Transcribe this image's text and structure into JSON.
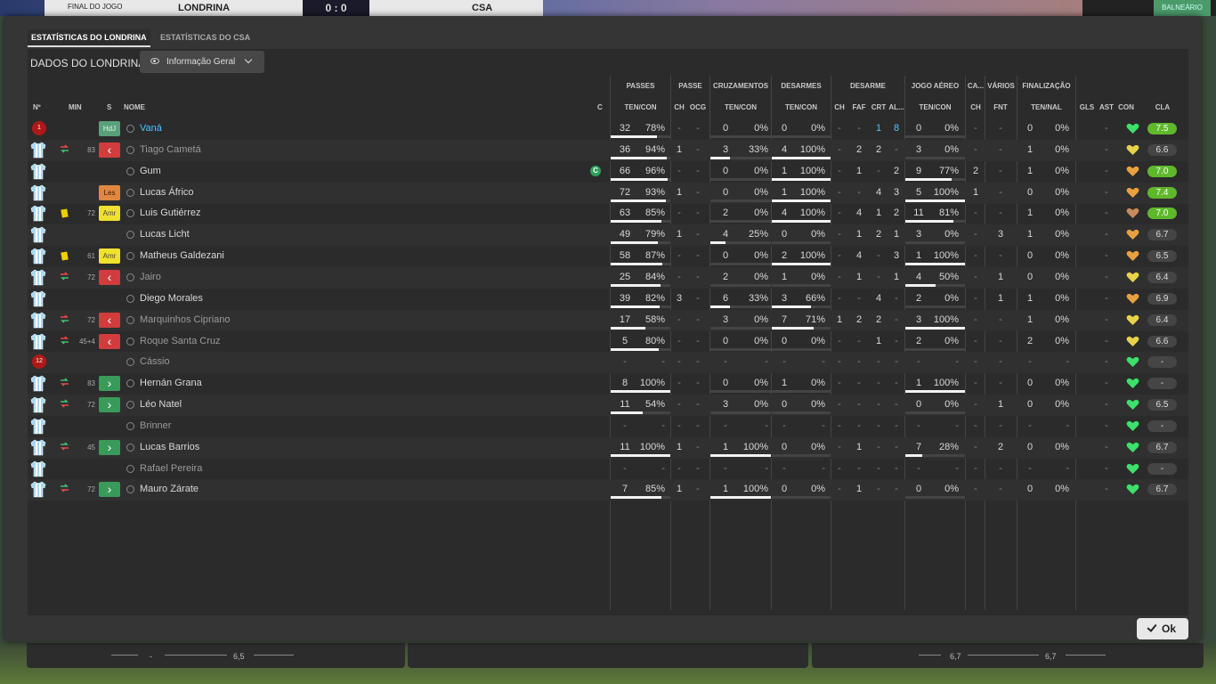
{
  "background": {
    "status": "FINAL DO JOGO",
    "home_team": "LONDRINA",
    "score": "0 : 0",
    "away_team": "CSA",
    "locker_btn": "BALNEÁRIO",
    "footer_values": [
      "-",
      "6,5",
      "6,7",
      "6,7"
    ]
  },
  "tabs": [
    {
      "label": "ESTATÍSTICAS DO LONDRINA",
      "active": true
    },
    {
      "label": "ESTATÍSTICAS DO CSA",
      "active": false
    }
  ],
  "panel": {
    "title": "DADOS DO LONDRINA",
    "view_select": "Informação Geral"
  },
  "headers": {
    "groups": [
      "PASSES",
      "PASSE",
      "CRUZAMENTOS",
      "DESARMES",
      "DESARME",
      "JOGO AÉREO",
      "CA...",
      "VÁRIOS",
      "FINALIZAÇÃO"
    ],
    "left": [
      "Nº",
      "MIN",
      "S",
      "NOME",
      "C"
    ],
    "sub": [
      "TEN/CON",
      "CH",
      "OCG",
      "TEN/CON",
      "TEN/CON",
      "CH",
      "FAF",
      "CRT",
      "AL...",
      "TEN/CON",
      "CH",
      "FNT",
      "TEN/NAL",
      "GLS",
      "AST",
      "CON",
      "CLA"
    ]
  },
  "colors": {
    "accent_blue": "#4fc3ff",
    "green": "#5fb82c",
    "red_badge": "#d23c3c",
    "green_badge": "#3a9a5a"
  },
  "players": [
    {
      "name": "Vaná",
      "num": "1",
      "kit": "gk",
      "event": "",
      "min": "",
      "badge": "HdJ",
      "badge_type": "hdj",
      "hl": true,
      "dim": false,
      "cap": false,
      "pass": [
        "32",
        "78%"
      ],
      "pass_fill": 0.78,
      "p_ch": "-",
      "p_ocg": "-",
      "cross": [
        "0",
        "0%"
      ],
      "cross_fill": 0,
      "tk": [
        "0",
        "0%"
      ],
      "tk_fill": 0,
      "d_ch": "-",
      "d_faf": "-",
      "d_crt": "1",
      "d_al": "8",
      "blue_crt": true,
      "blue_al": true,
      "air": [
        "0",
        "0%"
      ],
      "air_fill": 0,
      "ca": "-",
      "fnt": "-",
      "fin": [
        "0",
        "0%"
      ],
      "gls": "",
      "ast": "-",
      "heart": "green",
      "cla": "7.5",
      "cla_green": true
    },
    {
      "name": "Tiago Cametá",
      "num": "",
      "kit": "field",
      "event": "subout",
      "min": "83",
      "badge": "",
      "badge_type": "sub-out",
      "hl": false,
      "dim": true,
      "cap": false,
      "pass": [
        "36",
        "94%"
      ],
      "pass_fill": 0.94,
      "p_ch": "1",
      "p_ocg": "-",
      "cross": [
        "3",
        "33%"
      ],
      "cross_fill": 0.33,
      "tk": [
        "4",
        "100%"
      ],
      "tk_fill": 1,
      "d_ch": "-",
      "d_faf": "2",
      "d_crt": "2",
      "d_al": "-",
      "air": [
        "3",
        "0%"
      ],
      "air_fill": 0,
      "ca": "-",
      "fnt": "-",
      "fin": [
        "1",
        "0%"
      ],
      "gls": "",
      "ast": "-",
      "heart": "yellow",
      "cla": "6.6",
      "cla_green": false
    },
    {
      "name": "Gum",
      "num": "",
      "kit": "field",
      "event": "",
      "min": "",
      "badge": "",
      "badge_type": "",
      "hl": false,
      "dim": false,
      "cap": true,
      "pass": [
        "66",
        "96%"
      ],
      "pass_fill": 0.96,
      "p_ch": "-",
      "p_ocg": "-",
      "cross": [
        "0",
        "0%"
      ],
      "cross_fill": 0,
      "tk": [
        "1",
        "100%"
      ],
      "tk_fill": 1,
      "d_ch": "-",
      "d_faf": "1",
      "d_crt": "-",
      "d_al": "2",
      "air": [
        "9",
        "77%"
      ],
      "air_fill": 0.77,
      "ca": "2",
      "fnt": "-",
      "fin": [
        "1",
        "0%"
      ],
      "gls": "",
      "ast": "-",
      "heart": "orange",
      "cla": "7.0",
      "cla_green": true
    },
    {
      "name": "Lucas Áfrico",
      "num": "",
      "kit": "field",
      "event": "",
      "min": "",
      "badge": "Les",
      "badge_type": "les",
      "hl": false,
      "dim": false,
      "cap": false,
      "pass": [
        "72",
        "93%"
      ],
      "pass_fill": 0.93,
      "p_ch": "1",
      "p_ocg": "-",
      "cross": [
        "0",
        "0%"
      ],
      "cross_fill": 0,
      "tk": [
        "1",
        "100%"
      ],
      "tk_fill": 1,
      "d_ch": "-",
      "d_faf": "-",
      "d_crt": "4",
      "d_al": "3",
      "air": [
        "5",
        "100%"
      ],
      "air_fill": 1,
      "ca": "1",
      "fnt": "-",
      "fin": [
        "0",
        "0%"
      ],
      "gls": "",
      "ast": "-",
      "heart": "orange",
      "cla": "7.4",
      "cla_green": true
    },
    {
      "name": "Luis Gutiérrez",
      "num": "",
      "kit": "field",
      "event": "yellow",
      "min": "72",
      "badge": "Amr",
      "badge_type": "amr",
      "hl": false,
      "dim": false,
      "cap": false,
      "pass": [
        "63",
        "85%"
      ],
      "pass_fill": 0.85,
      "p_ch": "-",
      "p_ocg": "-",
      "cross": [
        "2",
        "0%"
      ],
      "cross_fill": 0,
      "tk": [
        "4",
        "100%"
      ],
      "tk_fill": 1,
      "d_ch": "-",
      "d_faf": "4",
      "d_crt": "1",
      "d_al": "2",
      "air": [
        "11",
        "81%"
      ],
      "air_fill": 0.81,
      "ca": "-",
      "fnt": "-",
      "fin": [
        "1",
        "0%"
      ],
      "gls": "",
      "ast": "-",
      "heart": "brown",
      "cla": "7.0",
      "cla_green": true
    },
    {
      "name": "Lucas Licht",
      "num": "",
      "kit": "field",
      "event": "",
      "min": "",
      "badge": "",
      "badge_type": "",
      "hl": false,
      "dim": false,
      "cap": false,
      "pass": [
        "49",
        "79%"
      ],
      "pass_fill": 0.79,
      "p_ch": "1",
      "p_ocg": "-",
      "cross": [
        "4",
        "25%"
      ],
      "cross_fill": 0.25,
      "tk": [
        "0",
        "0%"
      ],
      "tk_fill": 0,
      "d_ch": "-",
      "d_faf": "1",
      "d_crt": "2",
      "d_al": "1",
      "air": [
        "3",
        "0%"
      ],
      "air_fill": 0,
      "ca": "-",
      "fnt": "3",
      "fin": [
        "1",
        "0%"
      ],
      "gls": "",
      "ast": "-",
      "heart": "orange",
      "cla": "6.7",
      "cla_green": false
    },
    {
      "name": "Matheus Galdezani",
      "num": "",
      "kit": "field",
      "event": "yellow",
      "min": "61",
      "badge": "Amr",
      "badge_type": "amr",
      "hl": false,
      "dim": false,
      "cap": false,
      "pass": [
        "58",
        "87%"
      ],
      "pass_fill": 0.87,
      "p_ch": "-",
      "p_ocg": "-",
      "cross": [
        "0",
        "0%"
      ],
      "cross_fill": 0,
      "tk": [
        "2",
        "100%"
      ],
      "tk_fill": 1,
      "d_ch": "-",
      "d_faf": "4",
      "d_crt": "-",
      "d_al": "3",
      "air": [
        "1",
        "100%"
      ],
      "air_fill": 1,
      "ca": "-",
      "fnt": "-",
      "fin": [
        "0",
        "0%"
      ],
      "gls": "",
      "ast": "-",
      "heart": "orange",
      "cla": "6.5",
      "cla_green": false
    },
    {
      "name": "Jairo",
      "num": "",
      "kit": "field",
      "event": "subout",
      "min": "72",
      "badge": "",
      "badge_type": "sub-out",
      "hl": false,
      "dim": true,
      "cap": false,
      "pass": [
        "25",
        "84%"
      ],
      "pass_fill": 0.84,
      "p_ch": "-",
      "p_ocg": "-",
      "cross": [
        "2",
        "0%"
      ],
      "cross_fill": 0,
      "tk": [
        "1",
        "0%"
      ],
      "tk_fill": 0,
      "d_ch": "-",
      "d_faf": "1",
      "d_crt": "-",
      "d_al": "1",
      "air": [
        "4",
        "50%"
      ],
      "air_fill": 0.5,
      "ca": "-",
      "fnt": "1",
      "fin": [
        "0",
        "0%"
      ],
      "gls": "",
      "ast": "-",
      "heart": "yellow",
      "cla": "6.4",
      "cla_green": false
    },
    {
      "name": "Diego Morales",
      "num": "",
      "kit": "field",
      "event": "",
      "min": "",
      "badge": "",
      "badge_type": "",
      "hl": false,
      "dim": false,
      "cap": false,
      "pass": [
        "39",
        "82%"
      ],
      "pass_fill": 0.82,
      "p_ch": "3",
      "p_ocg": "-",
      "cross": [
        "6",
        "33%"
      ],
      "cross_fill": 0.33,
      "tk": [
        "3",
        "66%"
      ],
      "tk_fill": 0.66,
      "d_ch": "-",
      "d_faf": "-",
      "d_crt": "4",
      "d_al": "-",
      "air": [
        "2",
        "0%"
      ],
      "air_fill": 0,
      "ca": "-",
      "fnt": "1",
      "fin": [
        "1",
        "0%"
      ],
      "gls": "",
      "ast": "-",
      "heart": "orange",
      "cla": "6.9",
      "cla_green": false
    },
    {
      "name": "Marquinhos Cipriano",
      "num": "",
      "kit": "field",
      "event": "subout",
      "min": "72",
      "badge": "",
      "badge_type": "sub-out",
      "hl": false,
      "dim": true,
      "cap": false,
      "pass": [
        "17",
        "58%"
      ],
      "pass_fill": 0.58,
      "p_ch": "-",
      "p_ocg": "-",
      "cross": [
        "3",
        "0%"
      ],
      "cross_fill": 0,
      "tk": [
        "7",
        "71%"
      ],
      "tk_fill": 0.71,
      "d_ch": "1",
      "d_faf": "2",
      "d_crt": "2",
      "d_al": "-",
      "air": [
        "3",
        "100%"
      ],
      "air_fill": 1,
      "ca": "-",
      "fnt": "-",
      "fin": [
        "1",
        "0%"
      ],
      "gls": "",
      "ast": "-",
      "heart": "yellow",
      "cla": "6.4",
      "cla_green": false
    },
    {
      "name": "Roque Santa Cruz",
      "num": "",
      "kit": "field",
      "event": "subout",
      "min": "45+4",
      "badge": "",
      "badge_type": "sub-out",
      "hl": false,
      "dim": true,
      "cap": false,
      "pass": [
        "5",
        "80%"
      ],
      "pass_fill": 0.8,
      "p_ch": "-",
      "p_ocg": "-",
      "cross": [
        "0",
        "0%"
      ],
      "cross_fill": 0,
      "tk": [
        "0",
        "0%"
      ],
      "tk_fill": 0,
      "d_ch": "-",
      "d_faf": "-",
      "d_crt": "1",
      "d_al": "-",
      "air": [
        "2",
        "0%"
      ],
      "air_fill": 0,
      "ca": "-",
      "fnt": "-",
      "fin": [
        "2",
        "0%"
      ],
      "gls": "",
      "ast": "-",
      "heart": "yellow",
      "cla": "6.6",
      "cla_green": false
    },
    {
      "name": "Cássio",
      "num": "12",
      "kit": "gk",
      "event": "",
      "min": "",
      "badge": "",
      "badge_type": "",
      "hl": false,
      "dim": true,
      "cap": false,
      "pass": [
        "-",
        "-"
      ],
      "pass_fill": 0,
      "p_ch": "-",
      "p_ocg": "-",
      "cross": [
        "-",
        "-"
      ],
      "cross_fill": 0,
      "tk": [
        "-",
        "-"
      ],
      "tk_fill": 0,
      "d_ch": "-",
      "d_faf": "-",
      "d_crt": "-",
      "d_al": "-",
      "air": [
        "-",
        "-"
      ],
      "air_fill": 0,
      "ca": "-",
      "fnt": "-",
      "fin": [
        "-",
        "-"
      ],
      "gls": "",
      "ast": "-",
      "heart": "green",
      "cla": "-",
      "cla_green": false
    },
    {
      "name": "Hernán Grana",
      "num": "",
      "kit": "field",
      "event": "subin",
      "min": "83",
      "badge": "",
      "badge_type": "sub-in",
      "hl": false,
      "dim": false,
      "cap": false,
      "pass": [
        "8",
        "100%"
      ],
      "pass_fill": 1,
      "p_ch": "-",
      "p_ocg": "-",
      "cross": [
        "0",
        "0%"
      ],
      "cross_fill": 0,
      "tk": [
        "1",
        "0%"
      ],
      "tk_fill": 0,
      "d_ch": "-",
      "d_faf": "-",
      "d_crt": "-",
      "d_al": "-",
      "air": [
        "1",
        "100%"
      ],
      "air_fill": 1,
      "ca": "-",
      "fnt": "-",
      "fin": [
        "0",
        "0%"
      ],
      "gls": "",
      "ast": "-",
      "heart": "green",
      "cla": "-",
      "cla_green": false
    },
    {
      "name": "Léo Natel",
      "num": "",
      "kit": "field",
      "event": "subin",
      "min": "72",
      "badge": "",
      "badge_type": "sub-in",
      "hl": false,
      "dim": false,
      "cap": false,
      "pass": [
        "11",
        "54%"
      ],
      "pass_fill": 0.54,
      "p_ch": "-",
      "p_ocg": "-",
      "cross": [
        "3",
        "0%"
      ],
      "cross_fill": 0,
      "tk": [
        "0",
        "0%"
      ],
      "tk_fill": 0,
      "d_ch": "-",
      "d_faf": "-",
      "d_crt": "-",
      "d_al": "-",
      "air": [
        "0",
        "0%"
      ],
      "air_fill": 0,
      "ca": "-",
      "fnt": "1",
      "fin": [
        "0",
        "0%"
      ],
      "gls": "",
      "ast": "-",
      "heart": "green",
      "cla": "6.5",
      "cla_green": false
    },
    {
      "name": "Brinner",
      "num": "",
      "kit": "field",
      "event": "",
      "min": "",
      "badge": "",
      "badge_type": "",
      "hl": false,
      "dim": true,
      "cap": false,
      "pass": [
        "-",
        "-"
      ],
      "pass_fill": 0,
      "p_ch": "-",
      "p_ocg": "-",
      "cross": [
        "-",
        "-"
      ],
      "cross_fill": 0,
      "tk": [
        "-",
        "-"
      ],
      "tk_fill": 0,
      "d_ch": "-",
      "d_faf": "-",
      "d_crt": "-",
      "d_al": "-",
      "air": [
        "-",
        "-"
      ],
      "air_fill": 0,
      "ca": "-",
      "fnt": "-",
      "fin": [
        "-",
        "-"
      ],
      "gls": "",
      "ast": "-",
      "heart": "green",
      "cla": "-",
      "cla_green": false
    },
    {
      "name": "Lucas Barrios",
      "num": "",
      "kit": "field",
      "event": "subin",
      "min": "45",
      "badge": "",
      "badge_type": "sub-in",
      "hl": false,
      "dim": false,
      "cap": false,
      "pass": [
        "11",
        "100%"
      ],
      "pass_fill": 1,
      "p_ch": "1",
      "p_ocg": "-",
      "cross": [
        "1",
        "100%"
      ],
      "cross_fill": 1,
      "tk": [
        "0",
        "0%"
      ],
      "tk_fill": 0,
      "d_ch": "-",
      "d_faf": "1",
      "d_crt": "-",
      "d_al": "-",
      "air": [
        "7",
        "28%"
      ],
      "air_fill": 0.28,
      "ca": "-",
      "fnt": "2",
      "fin": [
        "0",
        "0%"
      ],
      "gls": "",
      "ast": "-",
      "heart": "green",
      "cla": "6.7",
      "cla_green": false
    },
    {
      "name": "Rafael Pereira",
      "num": "",
      "kit": "field",
      "event": "",
      "min": "",
      "badge": "",
      "badge_type": "",
      "hl": false,
      "dim": true,
      "cap": false,
      "pass": [
        "-",
        "-"
      ],
      "pass_fill": 0,
      "p_ch": "-",
      "p_ocg": "-",
      "cross": [
        "-",
        "-"
      ],
      "cross_fill": 0,
      "tk": [
        "-",
        "-"
      ],
      "tk_fill": 0,
      "d_ch": "-",
      "d_faf": "-",
      "d_crt": "-",
      "d_al": "-",
      "air": [
        "-",
        "-"
      ],
      "air_fill": 0,
      "ca": "-",
      "fnt": "-",
      "fin": [
        "-",
        "-"
      ],
      "gls": "",
      "ast": "-",
      "heart": "green",
      "cla": "-",
      "cla_green": false
    },
    {
      "name": "Mauro Zárate",
      "num": "",
      "kit": "field",
      "event": "subin",
      "min": "72",
      "badge": "",
      "badge_type": "sub-in",
      "hl": false,
      "dim": false,
      "cap": false,
      "pass": [
        "7",
        "85%"
      ],
      "pass_fill": 0.85,
      "p_ch": "1",
      "p_ocg": "-",
      "cross": [
        "1",
        "100%"
      ],
      "cross_fill": 1,
      "tk": [
        "0",
        "0%"
      ],
      "tk_fill": 0,
      "d_ch": "-",
      "d_faf": "1",
      "d_crt": "-",
      "d_al": "-",
      "air": [
        "0",
        "0%"
      ],
      "air_fill": 0,
      "ca": "-",
      "fnt": "-",
      "fin": [
        "0",
        "0%"
      ],
      "gls": "",
      "ast": "-",
      "heart": "green",
      "cla": "6.7",
      "cla_green": false
    }
  ],
  "ok_label": "Ok"
}
